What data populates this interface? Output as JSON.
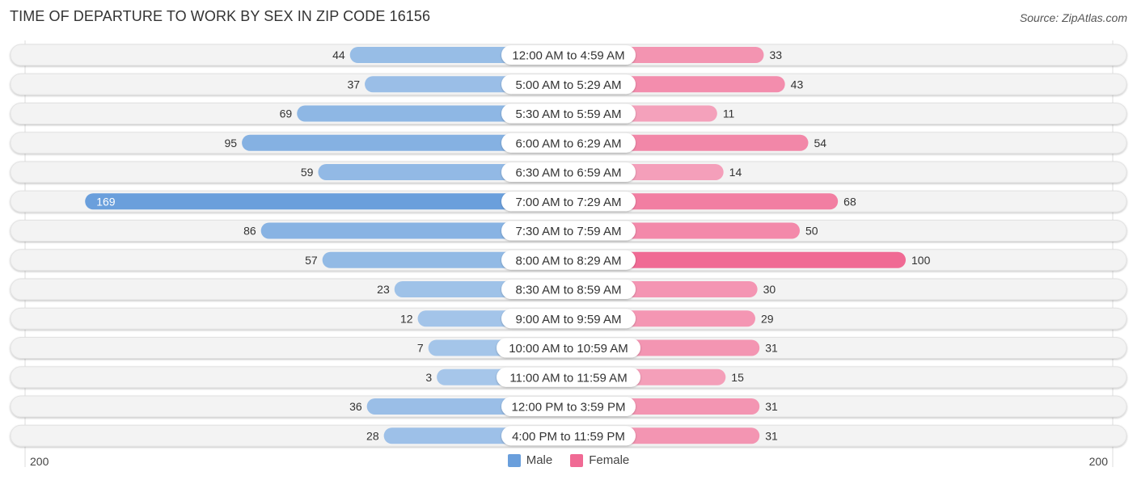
{
  "header": {
    "title": "TIME OF DEPARTURE TO WORK BY SEX IN ZIP CODE 16156",
    "source": "Source: ZipAtlas.com"
  },
  "legend": {
    "male_label": "Male",
    "female_label": "Female"
  },
  "axis": {
    "left_label": "200",
    "right_label": "200"
  },
  "colors": {
    "male": "#6a9fdc",
    "male_light": "#a7c7ea",
    "female": "#f06a94",
    "female_light": "#f5a8c0",
    "row_bg": "#f3f3f3"
  },
  "chart_data": {
    "type": "bar",
    "orientation": "horizontal-diverging",
    "title": "TIME OF DEPARTURE TO WORK BY SEX IN ZIP CODE 16156",
    "xlim": [
      -200,
      200
    ],
    "legend_position": "bottom-center",
    "categories": [
      "12:00 AM to 4:59 AM",
      "5:00 AM to 5:29 AM",
      "5:30 AM to 5:59 AM",
      "6:00 AM to 6:29 AM",
      "6:30 AM to 6:59 AM",
      "7:00 AM to 7:29 AM",
      "7:30 AM to 7:59 AM",
      "8:00 AM to 8:29 AM",
      "8:30 AM to 8:59 AM",
      "9:00 AM to 9:59 AM",
      "10:00 AM to 10:59 AM",
      "11:00 AM to 11:59 AM",
      "12:00 PM to 3:59 PM",
      "4:00 PM to 11:59 PM"
    ],
    "series": [
      {
        "name": "Male",
        "values": [
          44,
          37,
          69,
          95,
          59,
          169,
          86,
          57,
          23,
          12,
          7,
          3,
          36,
          28
        ]
      },
      {
        "name": "Female",
        "values": [
          33,
          43,
          11,
          54,
          14,
          68,
          50,
          100,
          30,
          29,
          31,
          15,
          31,
          31
        ]
      }
    ]
  }
}
